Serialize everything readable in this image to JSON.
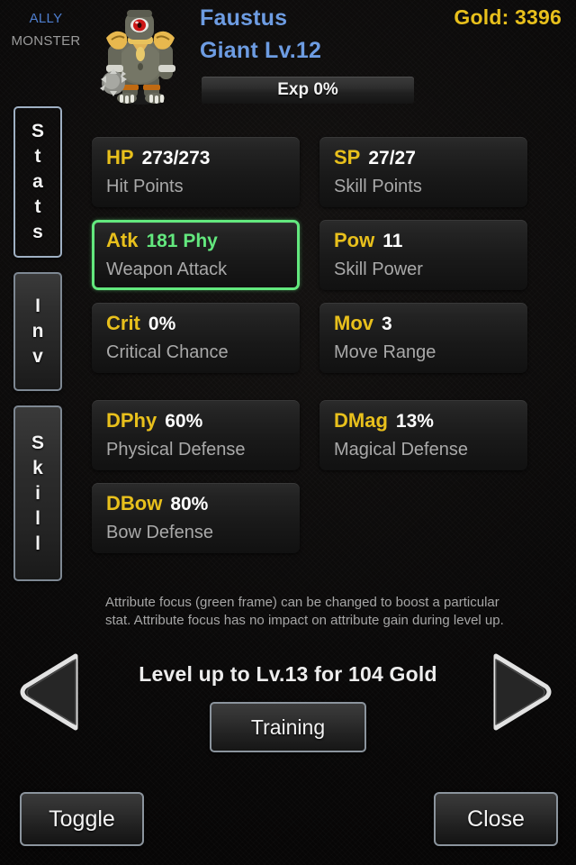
{
  "header": {
    "faction_active": "ALLY",
    "faction_inactive": "MONSTER",
    "character_name": "Faustus",
    "character_class_level": "Giant Lv.12",
    "gold": "Gold: 3396",
    "exp": "Exp 0%",
    "sprite_name": "giant-cyclops-sprite"
  },
  "sidebar": {
    "tabs": [
      {
        "label": "Stats",
        "letters": [
          "S",
          "t",
          "a",
          "t",
          "s"
        ],
        "active": true
      },
      {
        "label": "Inv",
        "letters": [
          "I",
          "n",
          "v"
        ],
        "active": false
      },
      {
        "label": "Skill",
        "letters": [
          "S",
          "k",
          "i",
          "l",
          "l"
        ],
        "active": false
      }
    ]
  },
  "stats": [
    {
      "abbr": "HP",
      "value": "273/273",
      "desc": "Hit Points",
      "focused": false
    },
    {
      "abbr": "SP",
      "value": "27/27",
      "desc": "Skill Points",
      "focused": false
    },
    {
      "abbr": "Atk",
      "value": "181 Phy",
      "desc": "Weapon Attack",
      "focused": true
    },
    {
      "abbr": "Pow",
      "value": "11",
      "desc": "Skill Power",
      "focused": false
    },
    {
      "abbr": "Crit",
      "value": "0%",
      "desc": "Critical Chance",
      "focused": false
    },
    {
      "abbr": "Mov",
      "value": "3",
      "desc": "Move Range",
      "focused": false
    },
    {
      "abbr": "DPhy",
      "value": "60%",
      "desc": "Physical Defense",
      "focused": false
    },
    {
      "abbr": "DMag",
      "value": "13%",
      "desc": "Magical Defense",
      "focused": false
    },
    {
      "abbr": "DBow",
      "value": "80%",
      "desc": "Bow Defense",
      "focused": false
    }
  ],
  "hint": "Attribute focus (green frame) can be changed to boost a particular stat. Attribute focus has no impact on attribute gain during level up.",
  "footer": {
    "levelup_text": "Level up to Lv.13 for 104 Gold",
    "training_label": "Training",
    "toggle_label": "Toggle",
    "close_label": "Close",
    "prev_icon": "left-arrow-icon",
    "next_icon": "right-arrow-icon"
  },
  "colors": {
    "accent_gold": "#e8c01c",
    "accent_blue": "#6d9ce2",
    "focus_green": "#63e87e",
    "value_white": "#ffffff",
    "desc_gray": "#a9a9a9",
    "background": "#0b0a0a"
  }
}
